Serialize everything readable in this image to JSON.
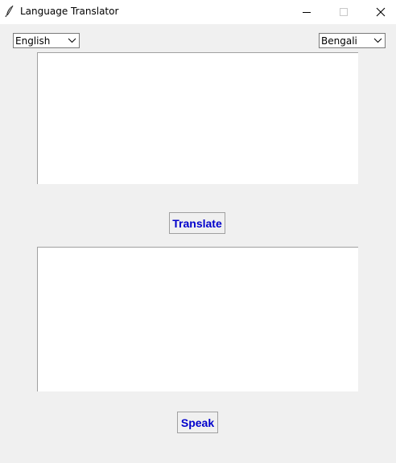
{
  "window": {
    "title": "Language Translator",
    "icon": "feather-icon"
  },
  "source_language": {
    "selected": "English"
  },
  "target_language": {
    "selected": "Bengali"
  },
  "input_text": {
    "value": ""
  },
  "output_text": {
    "value": ""
  },
  "buttons": {
    "translate_label": "Translate",
    "speak_label": "Speak"
  },
  "colors": {
    "button_text": "#0000cc",
    "background": "#f0f0f0"
  }
}
